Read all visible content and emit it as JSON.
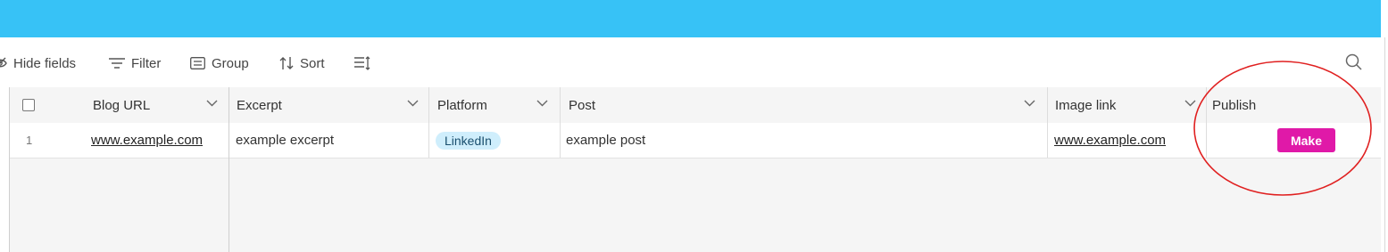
{
  "toolbar": {
    "hide_fields": "Hide fields",
    "filter": "Filter",
    "group": "Group",
    "sort": "Sort"
  },
  "columns": {
    "blog_url": "Blog URL",
    "excerpt": "Excerpt",
    "platform": "Platform",
    "post": "Post",
    "image_link": "Image link",
    "publish": "Publish"
  },
  "rows": [
    {
      "number": "1",
      "blog_url": "www.example.com",
      "excerpt": "example excerpt",
      "platform": "LinkedIn",
      "post": "example post",
      "image_link": "www.example.com",
      "publish_button": "Make"
    }
  ],
  "colors": {
    "topbar": "#37c2f6",
    "make_button": "#e019a8",
    "platform_pill": "#cfeefc",
    "annotation": "#e02020"
  }
}
